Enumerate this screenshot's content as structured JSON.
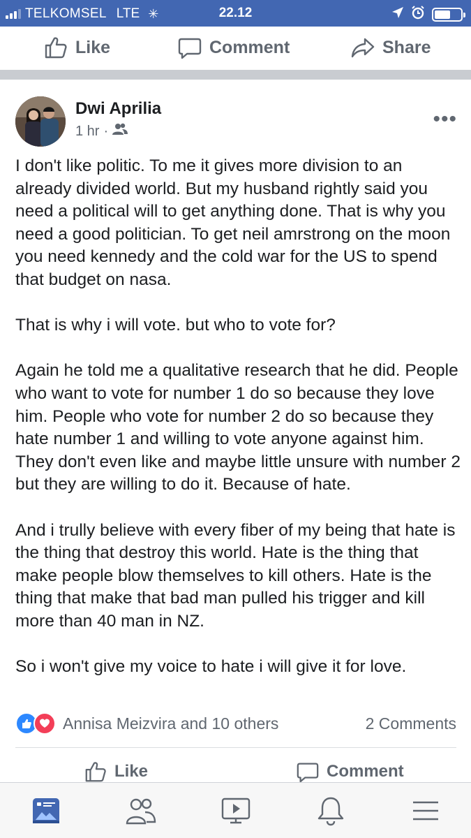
{
  "status_bar": {
    "carrier": "TELKOMSEL",
    "network": "LTE",
    "time": "22.12",
    "battery_level": 0.6
  },
  "top_actions": {
    "like": "Like",
    "comment": "Comment",
    "share": "Share"
  },
  "post": {
    "author": "Dwi Aprilia",
    "time": "1 hr",
    "separator": "·",
    "audience_icon": "friends-icon",
    "paragraphs": [
      "I don't like politic. To me it gives more division to an already divided world. But my husband rightly said you need a political will to get anything done. That is why you need a good politician. To get neil amrstrong on the moon you need kennedy and the cold war for the US to spend that budget on nasa.",
      "That is why i will vote. but who to vote for?",
      "Again he told me a qualitative research that he did. People who want to vote for number 1 do so because they love him. People who vote for number 2 do so because they hate number 1 and willing to vote anyone against him. They don't even like and maybe little unsure with number 2 but they are willing to do it. Because of hate.",
      "And i trully believe with every fiber of my being that hate is the thing that destroy this world. Hate is the thing that make people blow themselves to kill others. Hate is the thing that make that bad man pulled his trigger and kill more than 40 man in NZ.",
      "So i won't give my voice to hate i will give it for love."
    ],
    "reactions_text": "Annisa Meizvira and 10 others",
    "comments_count": "2 Comments",
    "like_label": "Like",
    "comment_label": "Comment"
  },
  "tabbar": {
    "tabs": [
      "news-feed-icon",
      "friends-icon",
      "watch-icon",
      "notifications-icon",
      "menu-icon"
    ],
    "active_tab": "news-feed-icon"
  },
  "colors": {
    "brand": "#4267b2",
    "text_secondary": "#606770",
    "like_blue": "#2d88ff",
    "love_red": "#f33e58"
  }
}
